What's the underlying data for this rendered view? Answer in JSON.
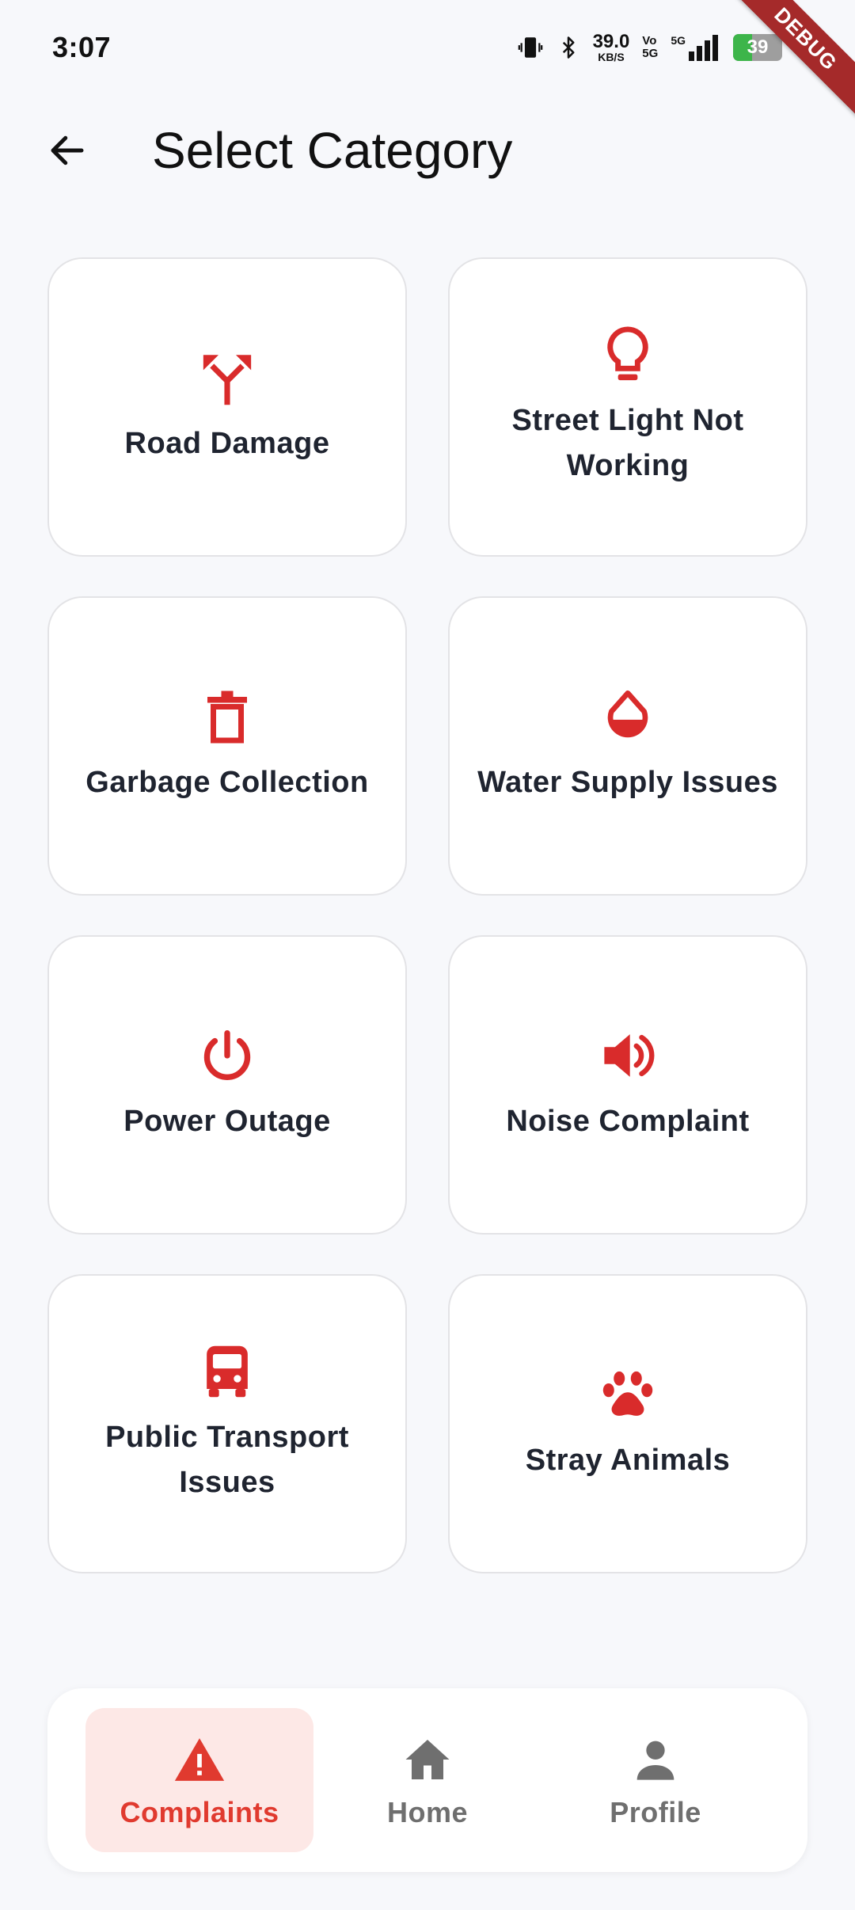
{
  "status_bar": {
    "time": "3:07",
    "net_speed_value": "39.0",
    "net_speed_unit": "KB/S",
    "volte_top": "Vo",
    "volte_bottom": "5G",
    "network_label": "5G",
    "battery_level": "39",
    "battery_fraction": 0.39
  },
  "debug_banner": "DEBUG",
  "app_bar": {
    "title": "Select Category",
    "back_icon": "arrow-back-icon"
  },
  "categories": [
    {
      "label": "Road Damage",
      "icon": "fork-road-icon"
    },
    {
      "label": "Street Light Not Working",
      "icon": "lightbulb-icon"
    },
    {
      "label": "Garbage Collection",
      "icon": "trash-icon"
    },
    {
      "label": "Water Supply Issues",
      "icon": "water-drop-icon"
    },
    {
      "label": "Power Outage",
      "icon": "power-icon"
    },
    {
      "label": "Noise Complaint",
      "icon": "speaker-icon"
    },
    {
      "label": "Public Transport Issues",
      "icon": "bus-icon"
    },
    {
      "label": "Stray Animals",
      "icon": "paw-icon"
    }
  ],
  "bottom_nav": [
    {
      "label": "Complaints",
      "icon": "warning-icon",
      "active": true
    },
    {
      "label": "Home",
      "icon": "home-icon",
      "active": false
    },
    {
      "label": "Profile",
      "icon": "person-icon",
      "active": false
    }
  ],
  "colors": {
    "accent": "#d92b2b",
    "active_nav_bg": "#fde8e6",
    "active_nav_text": "#e03a2f",
    "inactive_nav": "#6f6f6f",
    "background": "#f7f8fb",
    "card_border": "#e3e3e6",
    "debug_ribbon": "#a52a2a"
  }
}
